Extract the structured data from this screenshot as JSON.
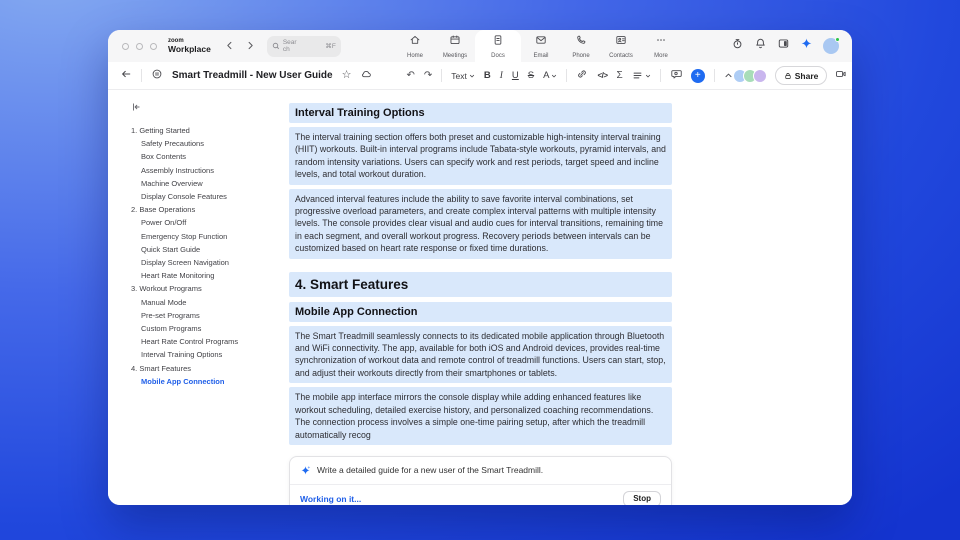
{
  "colors": {
    "accent": "#2160e8",
    "highlight": "#d9e8fb",
    "plus_button": "#1f6bf1",
    "presence": "#29c446"
  },
  "window": {
    "topbar": {
      "logo_line1": "zoom",
      "logo_line2": "Workplace",
      "search": {
        "placeholder": "Search",
        "shortcut": "⌘F"
      },
      "tabs": [
        {
          "name": "home",
          "label": "Home",
          "active": false
        },
        {
          "name": "meetings",
          "label": "Meetings",
          "active": false
        },
        {
          "name": "docs",
          "label": "Docs",
          "active": true
        },
        {
          "name": "email",
          "label": "Email",
          "active": false
        },
        {
          "name": "phone",
          "label": "Phone",
          "active": false
        },
        {
          "name": "contacts",
          "label": "Contacts",
          "active": false
        },
        {
          "name": "more",
          "label": "More",
          "active": false
        }
      ]
    },
    "toolbar": {
      "doc_title": "Smart Treadmill - New User Guide",
      "text_style_label": "Text",
      "format": {
        "bold": "B",
        "italic": "I",
        "underline": "U",
        "strikethrough": "S",
        "color": "A"
      },
      "code_label": "</>",
      "sigma_label": "Σ",
      "undo_glyph": "↶",
      "redo_glyph": "↷",
      "star_glyph": "☆",
      "plus_glyph": "+",
      "more_glyph": "···",
      "share_label": "Share"
    },
    "sidebar": {
      "items": [
        {
          "label": "1. Getting Started",
          "level": 0,
          "active": false
        },
        {
          "label": "Safety Precautions",
          "level": 1,
          "active": false
        },
        {
          "label": "Box Contents",
          "level": 1,
          "active": false
        },
        {
          "label": "Assembly Instructions",
          "level": 1,
          "active": false
        },
        {
          "label": "Machine Overview",
          "level": 1,
          "active": false
        },
        {
          "label": "Display Console Features",
          "level": 1,
          "active": false
        },
        {
          "label": "2. Base Operations",
          "level": 0,
          "active": false
        },
        {
          "label": "Power On/Off",
          "level": 1,
          "active": false
        },
        {
          "label": "Emergency Stop Function",
          "level": 1,
          "active": false
        },
        {
          "label": "Quick Start Guide",
          "level": 1,
          "active": false
        },
        {
          "label": "Display Screen Navigation",
          "level": 1,
          "active": false
        },
        {
          "label": "Heart Rate Monitoring",
          "level": 1,
          "active": false
        },
        {
          "label": "3. Workout Programs",
          "level": 0,
          "active": false
        },
        {
          "label": "Manual Mode",
          "level": 1,
          "active": false
        },
        {
          "label": "Pre-set Programs",
          "level": 1,
          "active": false
        },
        {
          "label": "Custom Programs",
          "level": 1,
          "active": false
        },
        {
          "label": "Heart Rate Control Programs",
          "level": 1,
          "active": false
        },
        {
          "label": "Interval Training Options",
          "level": 1,
          "active": false
        },
        {
          "label": "4. Smart Features",
          "level": 0,
          "active": false
        },
        {
          "label": "Mobile App Connection",
          "level": 1,
          "active": true
        }
      ]
    },
    "document": {
      "blocks": [
        {
          "type": "h2",
          "text": "Interval Training Options"
        },
        {
          "type": "p",
          "text": "The interval training section offers both preset and customizable high-intensity interval training (HIIT) workouts. Built-in interval programs include Tabata-style workouts, pyramid intervals, and random intensity variations. Users can specify work and rest periods, target speed and incline levels, and total workout duration."
        },
        {
          "type": "p",
          "text": "Advanced interval features include the ability to save favorite interval combinations, set progressive overload parameters, and create complex interval patterns with multiple intensity levels. The console provides clear visual and audio cues for interval transitions, remaining time in each segment, and overall workout progress. Recovery periods between intervals can be customized based on heart rate response or fixed time durations."
        },
        {
          "type": "h1",
          "text": "4. Smart Features"
        },
        {
          "type": "h2",
          "text": "Mobile App Connection"
        },
        {
          "type": "p",
          "text": "The Smart Treadmill seamlessly connects to its dedicated mobile application through Bluetooth and WiFi connectivity. The app, available for both iOS and Android devices, provides real-time synchronization of workout data and remote control of treadmill functions. Users can start, stop, and adjust their workouts directly from their smartphones or tablets."
        },
        {
          "type": "p",
          "text": "The mobile app interface mirrors the console display while adding enhanced features like workout scheduling, detailed exercise history, and personalized coaching recommendations. The connection process involves a simple one-time pairing setup, after which the treadmill automatically recog"
        }
      ]
    },
    "ai_panel": {
      "prompt": "Write a detailed guide for a new user of the Smart Treadmill.",
      "status": "Working on it...",
      "stop_label": "Stop"
    }
  }
}
